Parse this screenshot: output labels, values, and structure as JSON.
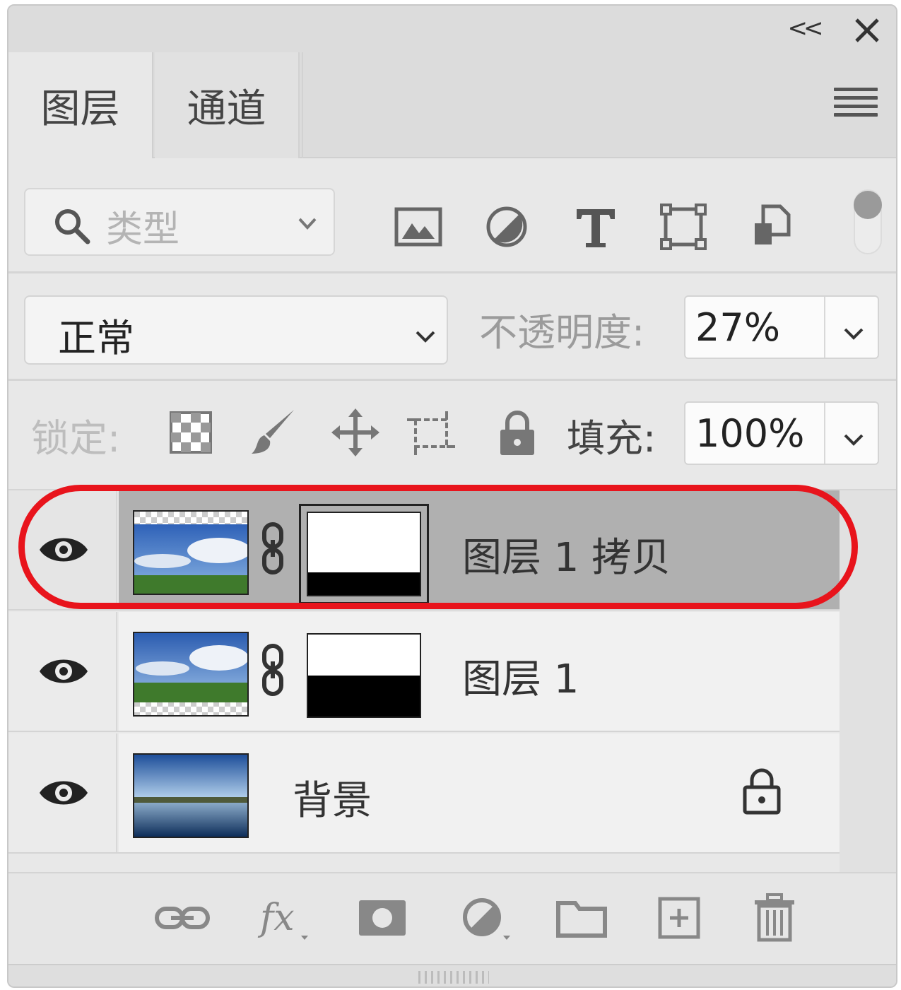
{
  "header": {
    "collapse_glyph": "<<",
    "close_glyph": "×"
  },
  "tabs": [
    {
      "label": "图层",
      "active": true
    },
    {
      "label": "通道",
      "active": false
    }
  ],
  "filter": {
    "placeholder": "类型",
    "icons": [
      "image-filter-icon",
      "adjustment-filter-icon",
      "type-filter-icon",
      "shape-filter-icon",
      "smart-object-filter-icon"
    ]
  },
  "blend": {
    "mode": "正常"
  },
  "opacity": {
    "label": "不透明度:",
    "value": "27%"
  },
  "lock": {
    "label": "锁定:",
    "icons": [
      "lock-transparent-icon",
      "lock-paint-icon",
      "lock-position-icon",
      "lock-artboard-icon",
      "lock-all-icon"
    ]
  },
  "fill": {
    "label": "填充:",
    "value": "100%"
  },
  "layers": [
    {
      "name": "图层 1 拷贝",
      "selected": true,
      "has_mask": true,
      "mask_black_fraction": 0.28,
      "thumbnail": "sky-field-transparent-top"
    },
    {
      "name": "图层 1",
      "selected": false,
      "has_mask": true,
      "mask_black_fraction": 0.5,
      "thumbnail": "sky-field-transparent-bottom"
    },
    {
      "name": "背景",
      "selected": false,
      "has_mask": false,
      "locked": true,
      "thumbnail": "lake-sky"
    }
  ],
  "bottom_icons": [
    "link-layers-icon",
    "fx-icon",
    "add-mask-icon",
    "adjustment-layer-icon",
    "new-group-icon",
    "new-layer-icon",
    "delete-icon"
  ],
  "colors": {
    "highlight": "#e8141c",
    "selected_row": "#b0b0b0",
    "panel": "#e8e8e8"
  }
}
